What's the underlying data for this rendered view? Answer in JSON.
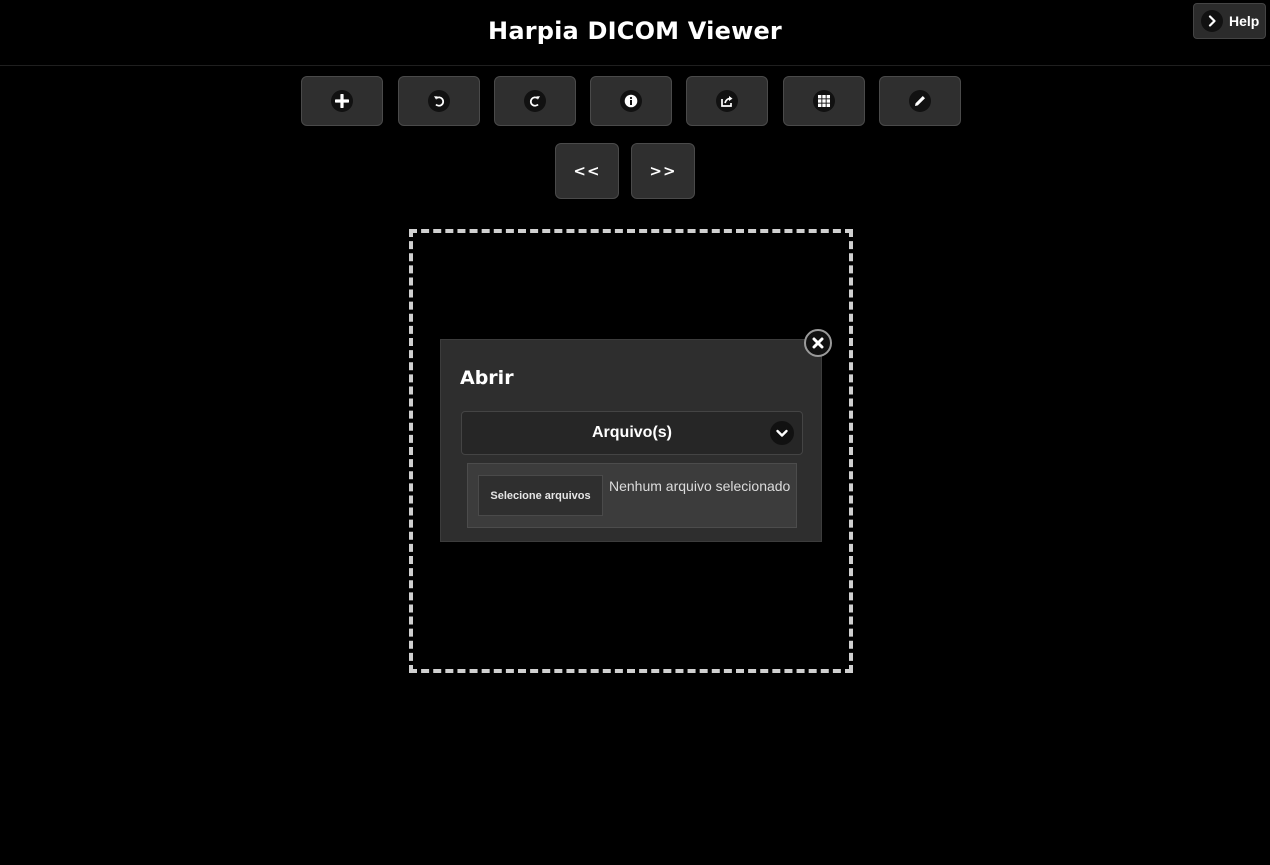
{
  "header": {
    "title": "Harpia DICOM Viewer",
    "help_label": "Help"
  },
  "toolbar": {
    "buttons": [
      {
        "icon": "plus-icon"
      },
      {
        "icon": "undo-icon"
      },
      {
        "icon": "redo-icon"
      },
      {
        "icon": "info-icon"
      },
      {
        "icon": "export-icon"
      },
      {
        "icon": "grid-icon"
      },
      {
        "icon": "pencil-icon"
      }
    ],
    "prev_label": "<<",
    "next_label": ">>"
  },
  "dialog": {
    "title": "Abrir",
    "source_select": {
      "selected": "Arquivo(s)"
    },
    "file_input": {
      "button_label": "Selecione arquivos",
      "status": "Nenhum arquivo selecionado"
    }
  },
  "colors": {
    "background": "#000000",
    "button_bg": "#2f2f2f",
    "dialog_bg": "#2e2e2e",
    "dropzone_border": "#d0d0d0"
  }
}
